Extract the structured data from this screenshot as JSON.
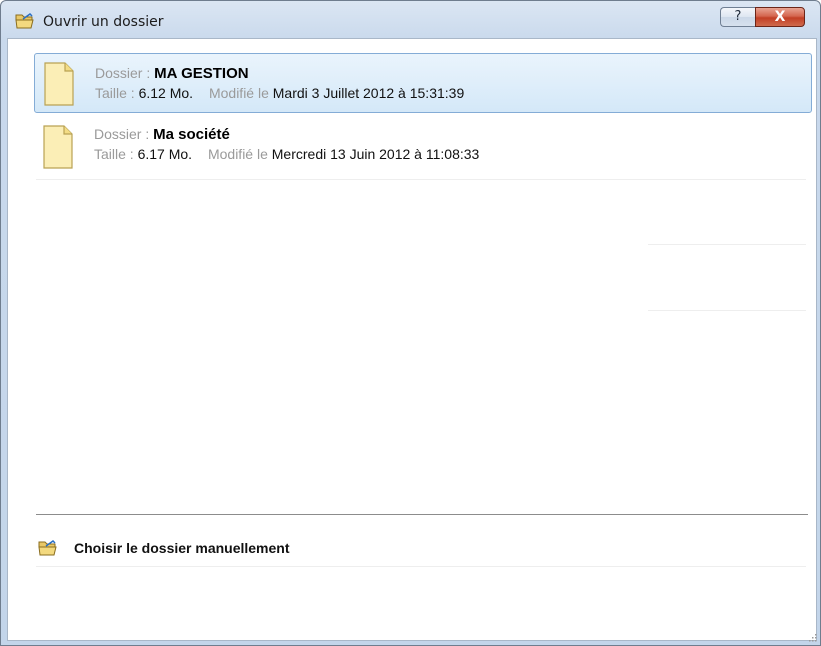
{
  "window": {
    "title": "Ouvrir un dossier",
    "help_label": "?",
    "close_label": "X"
  },
  "folders": [
    {
      "dossier_label": "Dossier :",
      "name": "MA GESTION",
      "taille_label": "Taille :",
      "size": "6.12 Mo.",
      "modifie_label": "Modifié le",
      "modified": "Mardi 3 Juillet 2012 à 15:31:39",
      "selected": true
    },
    {
      "dossier_label": "Dossier :",
      "name": "Ma société",
      "taille_label": "Taille :",
      "size": "6.17 Mo.",
      "modifie_label": "Modifié le",
      "modified": "Mercredi 13 Juin 2012 à 11:08:33",
      "selected": false
    }
  ],
  "manual": {
    "label": "Choisir le dossier manuellement"
  },
  "icons": {
    "title": "open-folder-icon",
    "folder": "document-icon",
    "manual": "open-folder-icon"
  },
  "colors": {
    "selection_border": "#84acd6",
    "selection_fill": "#d4e8f8",
    "close_button": "#c23f25"
  }
}
